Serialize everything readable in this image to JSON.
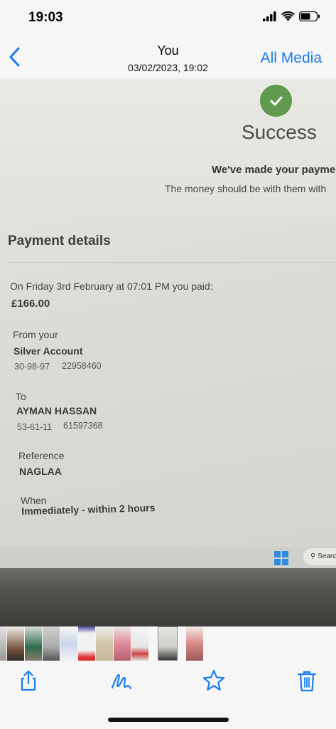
{
  "status_bar": {
    "time": "19:03"
  },
  "nav": {
    "title": "You",
    "subtitle": "03/02/2023, 19:02",
    "all_media": "All Media"
  },
  "photo": {
    "success": "Success",
    "made_payment": "We've made your payment.",
    "money_with": "The money should be with them with",
    "payment_details": "Payment details",
    "paid_line": "On Friday 3rd February at 07:01 PM you paid:",
    "amount": "£166.00",
    "from_label": "From your",
    "from_account": "Silver Account",
    "from_sort": "30-98-97",
    "from_number": "22958460",
    "to_label": "To",
    "to_name": "AYMAN HASSAN",
    "to_sort": "53-61-11",
    "to_number": "61597368",
    "reference_label": "Reference",
    "reference_value": "NAGLAA",
    "when_label": "When",
    "when_value": "Immediately - within 2 hours",
    "search_hint": "Searc"
  },
  "toolbar": {
    "share": "share-icon",
    "markup": "markup-icon",
    "favorite": "star-icon",
    "delete": "trash-icon"
  },
  "colors": {
    "accent": "#1a7cf0",
    "success_green": "#5f9a4d"
  }
}
